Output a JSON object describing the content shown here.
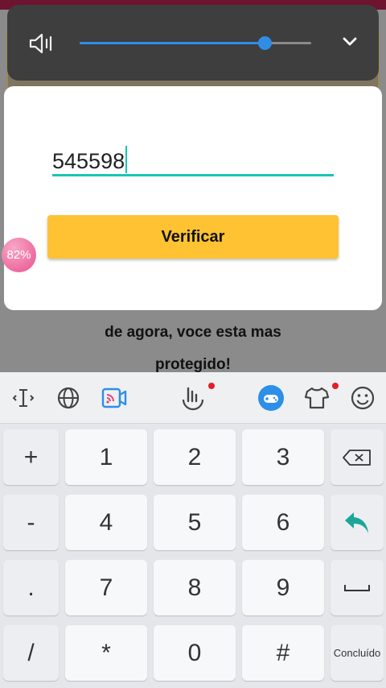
{
  "background": {
    "text_line1": "de agora,  voce esta mas",
    "text_line2": "protegido!"
  },
  "volume": {
    "level_percent": 80,
    "accent_color": "#2f8de4",
    "speaker_icon": "speaker-icon",
    "expand_icon": "chevron-down-icon"
  },
  "dialog": {
    "code_value": "545598",
    "verify_label": "Verificar",
    "accent_color": "#19c6b4",
    "button_color": "#fec233"
  },
  "battery": {
    "percent_label": "82%"
  },
  "keyboard": {
    "toolbar_icons": [
      "cursor-icon",
      "globe-icon",
      "video-icon",
      "handwriting-icon",
      "game-icon",
      "theme-icon",
      "emoji-icon"
    ],
    "rows": [
      {
        "side": "+",
        "keys": [
          "1",
          "2",
          "3"
        ],
        "action_icon": "backspace-icon"
      },
      {
        "side": "-",
        "keys": [
          "4",
          "5",
          "6"
        ],
        "action_icon": "enter-icon"
      },
      {
        "side": ".",
        "keys": [
          "7",
          "8",
          "9"
        ],
        "action_icon": "space-icon"
      },
      {
        "side": "/",
        "keys": [
          "*",
          "0",
          "#"
        ],
        "action_label": "Concluído"
      }
    ]
  }
}
